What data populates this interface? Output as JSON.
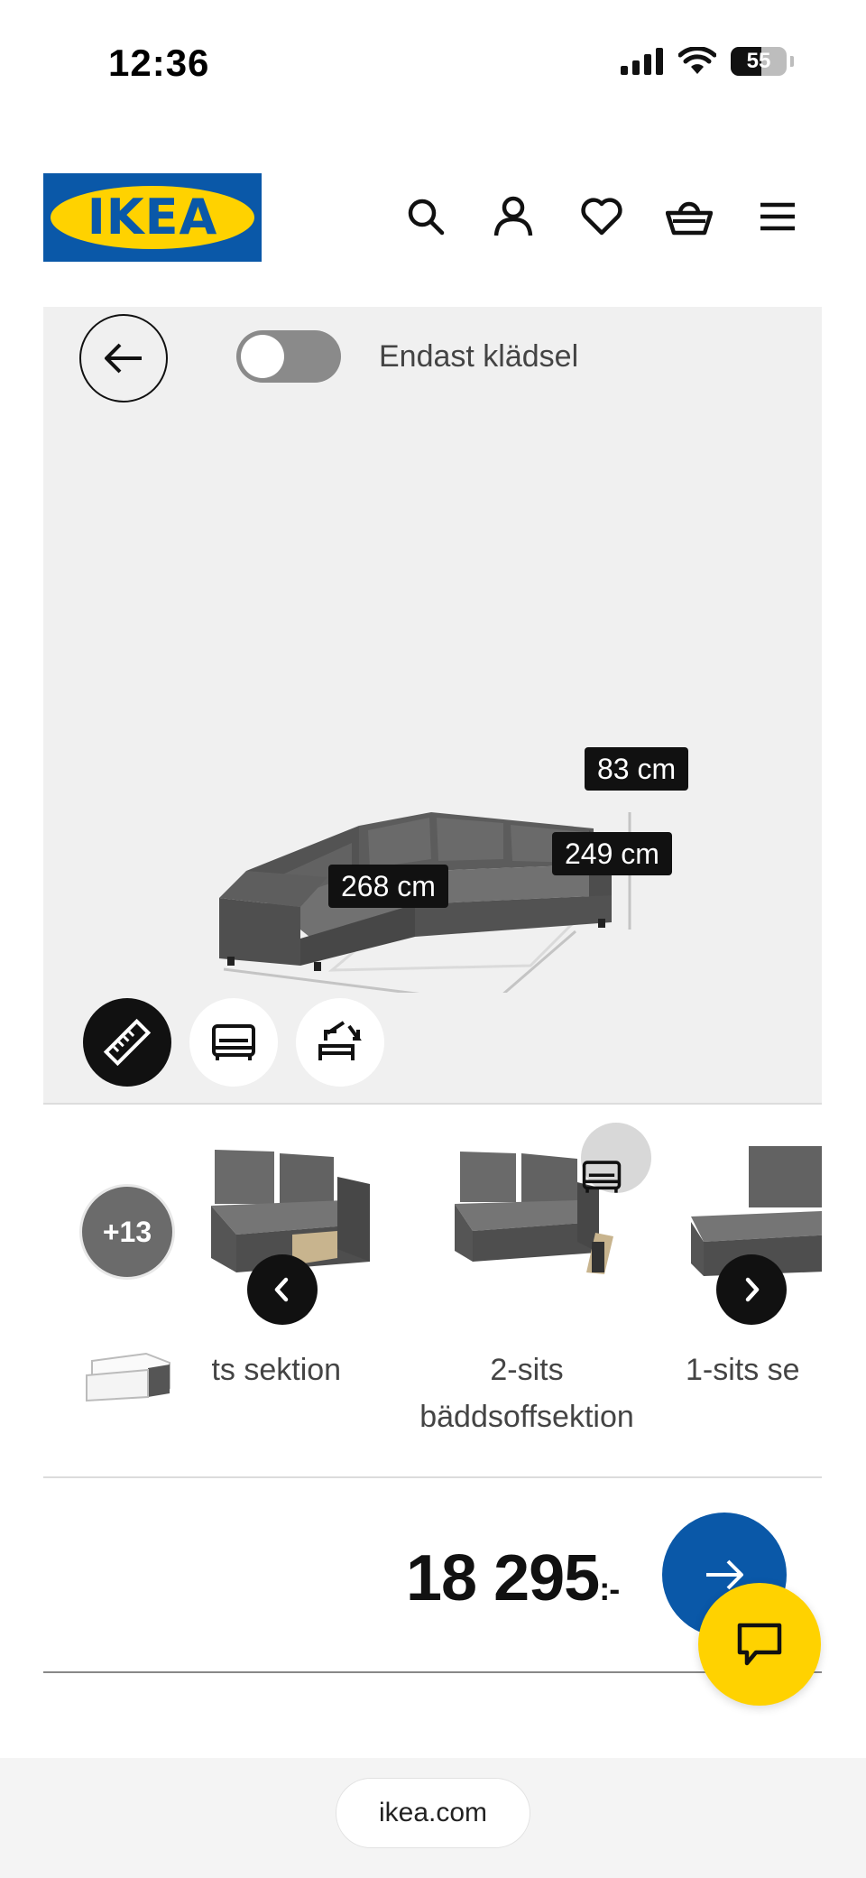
{
  "status_bar": {
    "time": "12:36",
    "battery_level": "55",
    "battery_fraction": 0.55
  },
  "header": {
    "logo_text": "IKEA",
    "icons": [
      "search-icon",
      "account-icon",
      "heart-icon",
      "basket-icon",
      "menu-icon"
    ],
    "brand_blue": "#0a58a8",
    "brand_yellow": "#ffd200"
  },
  "viewer": {
    "toggle_label": "Endast klädsel",
    "toggle_on": false,
    "dimensions": {
      "height": "83 cm",
      "depth": "249 cm",
      "width": "268 cm"
    },
    "tools": [
      "ruler-icon",
      "bed-icon",
      "compact-icon"
    ],
    "active_tool": "ruler-icon"
  },
  "carousel": {
    "more_count": "+13",
    "items": [
      {
        "label_line1": "sits sektion",
        "label_line2": ""
      },
      {
        "label_line1": "2-sits",
        "label_line2": "bäddsoffsektion",
        "has_bed_badge": true
      },
      {
        "label_line1": "1-sits se",
        "label_line2": ""
      }
    ]
  },
  "price": {
    "value": "18 295",
    "suffix": ":-"
  },
  "browser": {
    "url": "ikea.com"
  }
}
